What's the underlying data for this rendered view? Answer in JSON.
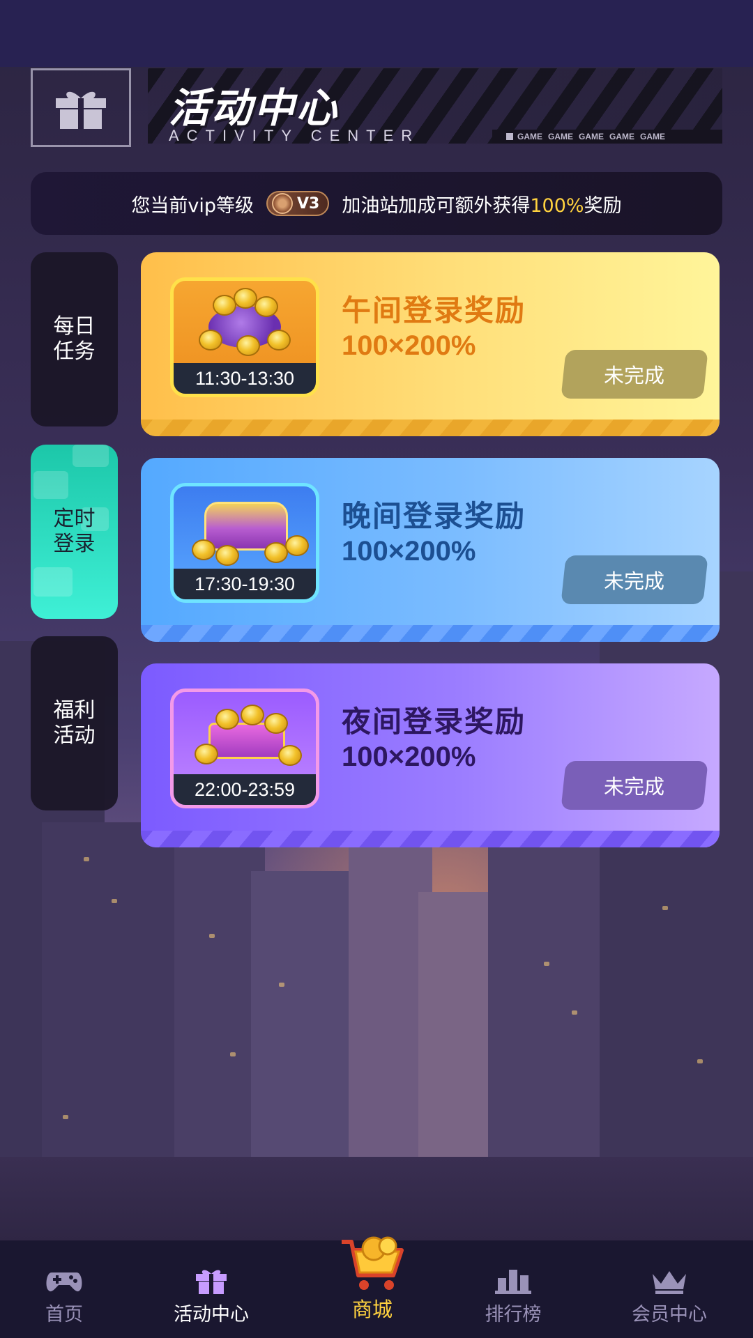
{
  "header": {
    "title": "活动中心",
    "subtitle": "ACTIVITY CENTER",
    "tags": [
      "GAME",
      "GAME",
      "GAME",
      "GAME",
      "GAME"
    ]
  },
  "vip": {
    "prefix": "您当前vip等级",
    "level": "V3",
    "middle": "加油站加成可额外获得",
    "percent": "100%",
    "suffix": "奖励"
  },
  "side_tabs": [
    {
      "label": "每日任务",
      "active": false
    },
    {
      "label": "定时登录",
      "active": true
    },
    {
      "label": "福利活动",
      "active": false
    }
  ],
  "cards": [
    {
      "title": "午间登录奖励",
      "value": "100×200%",
      "time": "11:30-13:30",
      "button": "未完成"
    },
    {
      "title": "晚间登录奖励",
      "value": "100×200%",
      "time": "17:30-19:30",
      "button": "未完成"
    },
    {
      "title": "夜间登录奖励",
      "value": "100×200%",
      "time": "22:00-23:59",
      "button": "未完成"
    }
  ],
  "nav": {
    "home": "首页",
    "activity": "活动中心",
    "shop": "商城",
    "ranking": "排行榜",
    "member": "会员中心"
  },
  "icons": {
    "header": "gift-icon",
    "home": "gamepad-icon",
    "activity": "gift-icon",
    "shop": "shopping-cart-icon",
    "ranking": "podium-icon",
    "member": "crown-icon"
  },
  "colors": {
    "accent_yellow": "#ffd23f",
    "active_tab": "#2ee6c8",
    "nav_bg": "#1a1730"
  }
}
